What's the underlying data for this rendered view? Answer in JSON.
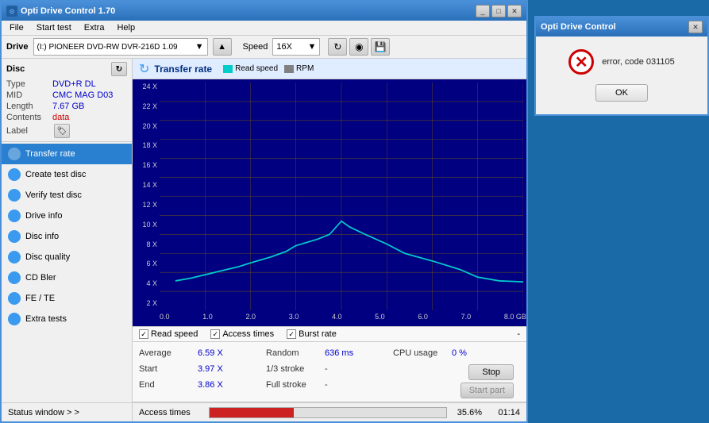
{
  "mainWindow": {
    "title": "Opti Drive Control 1.70",
    "titlebarBtns": [
      "_",
      "□",
      "✕"
    ]
  },
  "menu": {
    "items": [
      "File",
      "Start test",
      "Extra",
      "Help"
    ]
  },
  "driveBar": {
    "driveLabel": "Drive",
    "driveValue": "(I:) PIONEER DVD-RW DVR-216D 1.09",
    "speedLabel": "Speed",
    "speedValue": "16X"
  },
  "disc": {
    "header": "Disc",
    "fields": [
      {
        "label": "Type",
        "value": "DVD+R DL"
      },
      {
        "label": "MID",
        "value": "CMC MAG D03"
      },
      {
        "label": "Length",
        "value": "7.67 GB"
      },
      {
        "label": "Contents",
        "value": "data"
      },
      {
        "label": "Label",
        "value": ""
      }
    ]
  },
  "nav": {
    "items": [
      {
        "label": "Transfer rate",
        "active": true
      },
      {
        "label": "Create test disc",
        "active": false
      },
      {
        "label": "Verify test disc",
        "active": false
      },
      {
        "label": "Drive info",
        "active": false
      },
      {
        "label": "Disc info",
        "active": false
      },
      {
        "label": "Disc quality",
        "active": false
      },
      {
        "label": "CD Bler",
        "active": false
      },
      {
        "label": "FE / TE",
        "active": false
      },
      {
        "label": "Extra tests",
        "active": false
      }
    ],
    "statusWindow": "Status window > >"
  },
  "chart": {
    "title": "Transfer rate",
    "legend": [
      {
        "label": "Read speed",
        "color": "#00ffff"
      },
      {
        "label": "RPM",
        "color": "#808080"
      }
    ],
    "yLabels": [
      "24 X",
      "22 X",
      "20 X",
      "18 X",
      "16 X",
      "14 X",
      "12 X",
      "10 X",
      "8 X",
      "6 X",
      "4 X",
      "2 X"
    ],
    "xLabels": [
      "0.0",
      "1.0",
      "2.0",
      "3.0",
      "4.0",
      "5.0",
      "6.0",
      "7.0",
      "8.0 GB"
    ]
  },
  "checkboxes": [
    {
      "label": "Read speed",
      "checked": true
    },
    {
      "label": "Access times",
      "checked": true
    },
    {
      "label": "Burst rate",
      "checked": true
    },
    {
      "label": "dash",
      "value": "-"
    }
  ],
  "stats": {
    "average": {
      "label": "Average",
      "value": "6.59 X"
    },
    "start": {
      "label": "Start",
      "value": "3.97 X"
    },
    "end": {
      "label": "End",
      "value": "3.86 X"
    },
    "random": {
      "label": "Random",
      "value": "636 ms"
    },
    "stroke13": {
      "label": "1/3 stroke",
      "value": "-"
    },
    "fullStroke": {
      "label": "Full stroke",
      "value": "-"
    },
    "cpuUsage": {
      "label": "CPU usage",
      "value": "0 %"
    }
  },
  "buttons": {
    "stop": "Stop",
    "startPart": "Start part"
  },
  "progressBar": {
    "label": "Access times",
    "percent": "35.6%",
    "fillPercent": 35.6,
    "time": "01:14"
  },
  "errorDialog": {
    "title": "Opti Drive Control",
    "message": "error, code 031105",
    "okLabel": "OK"
  }
}
